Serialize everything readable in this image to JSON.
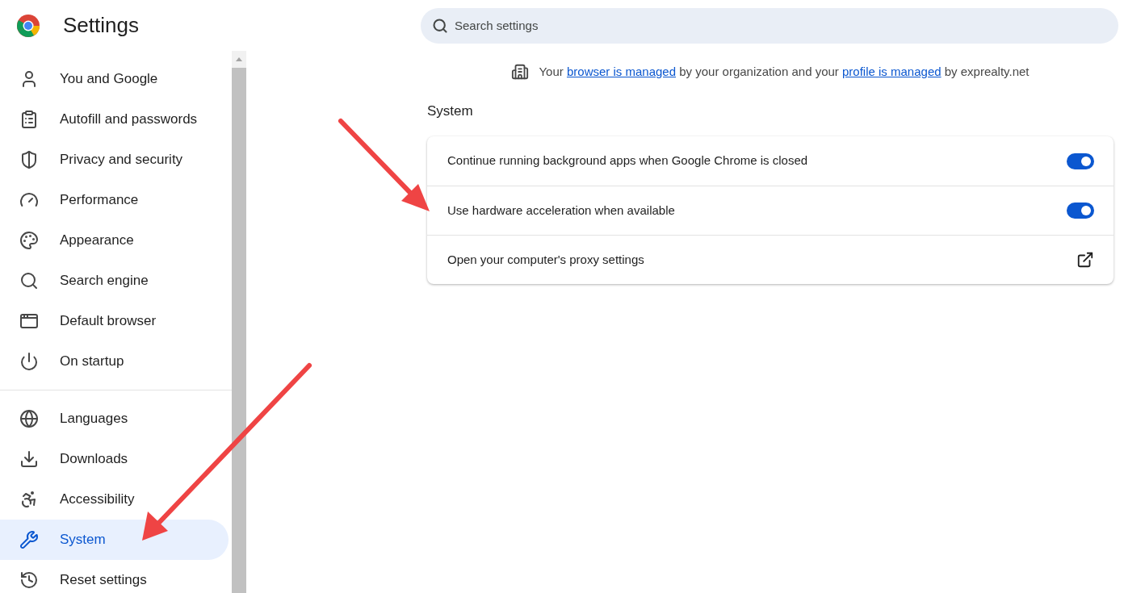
{
  "window": {
    "title": "Settings"
  },
  "search": {
    "placeholder": "Search settings"
  },
  "sidebar": {
    "groups": [
      {
        "items": [
          {
            "label": "You and Google",
            "selected": false
          },
          {
            "label": "Autofill and passwords",
            "selected": false
          },
          {
            "label": "Privacy and security",
            "selected": false
          },
          {
            "label": "Performance",
            "selected": false
          },
          {
            "label": "Appearance",
            "selected": false
          },
          {
            "label": "Search engine",
            "selected": false
          },
          {
            "label": "Default browser",
            "selected": false
          },
          {
            "label": "On startup",
            "selected": false
          }
        ]
      },
      {
        "items": [
          {
            "label": "Languages",
            "selected": false
          },
          {
            "label": "Downloads",
            "selected": false
          },
          {
            "label": "Accessibility",
            "selected": false
          },
          {
            "label": "System",
            "selected": true
          },
          {
            "label": "Reset settings",
            "selected": false
          }
        ]
      }
    ]
  },
  "notice": {
    "parts": [
      {
        "kind": "text",
        "text": "Your"
      },
      {
        "kind": "link",
        "text": "browser is managed"
      },
      {
        "kind": "text",
        "text": "by your organization and your"
      },
      {
        "kind": "link",
        "text": "profile is managed"
      },
      {
        "kind": "text",
        "text": "by exprealty.net"
      }
    ]
  },
  "section": {
    "title": "System",
    "rows": [
      {
        "kind": "toggle",
        "label": "Continue running background apps when Google Chrome is closed",
        "on": true
      },
      {
        "kind": "toggle",
        "label": "Use hardware acceleration when available",
        "on": true
      },
      {
        "kind": "external",
        "label": "Open your computer's proxy settings"
      }
    ]
  }
}
